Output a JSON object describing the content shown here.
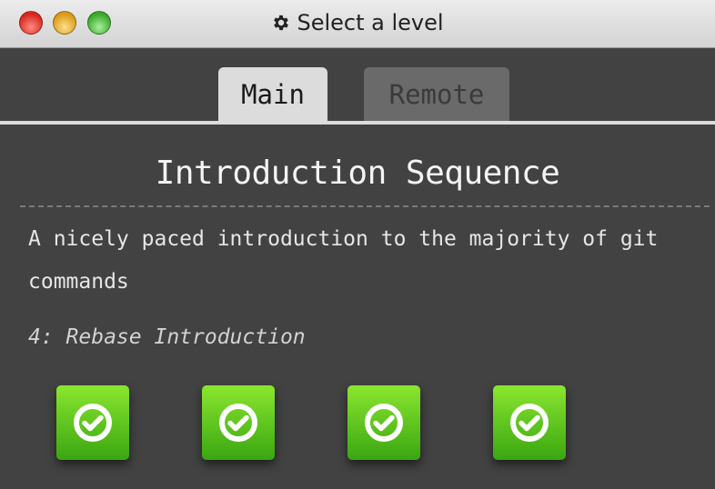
{
  "window": {
    "title": "Select a level",
    "title_icon": "gear-icon",
    "controls": [
      "close",
      "minimize",
      "maximize"
    ]
  },
  "tabs": [
    {
      "label": "Main",
      "active": true
    },
    {
      "label": "Remote",
      "active": false
    }
  ],
  "sequence": {
    "title": "Introduction Sequence",
    "description": "A nicely paced introduction to the majority of git commands",
    "selected_level": "4: Rebase Introduction"
  },
  "levels": [
    {
      "icon": "check-circle-icon",
      "completed": true
    },
    {
      "icon": "check-circle-icon",
      "completed": true
    },
    {
      "icon": "check-circle-icon",
      "completed": true
    },
    {
      "icon": "check-circle-icon",
      "completed": true
    }
  ],
  "colors": {
    "background": "#424242",
    "tab_active": "#dcdcdc",
    "tab_inactive": "#6a6a6a",
    "level_complete": "#5cc11f",
    "text": "#f4f4f4"
  }
}
